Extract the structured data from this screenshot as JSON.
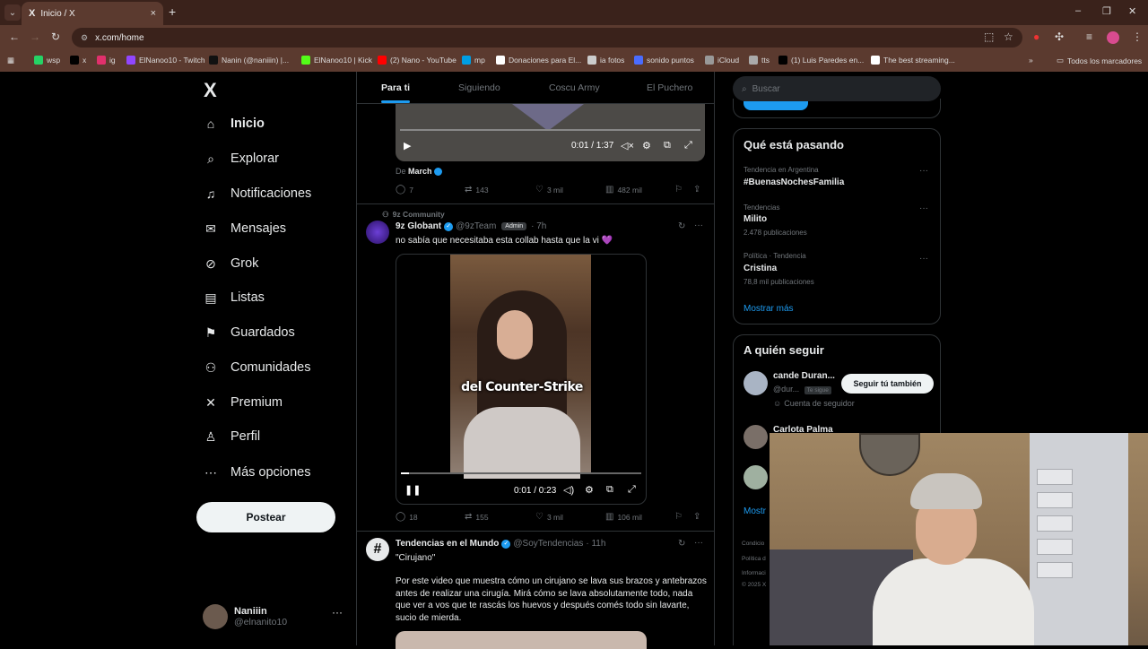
{
  "browser": {
    "tab_title": "Inicio / X",
    "tab_close": "×",
    "new_tab": "+",
    "url": "x.com/home",
    "win_min": "–",
    "win_max": "❐",
    "win_close": "✕",
    "bookmarks": [
      {
        "label": "wsp",
        "color": "#25d366"
      },
      {
        "label": "x",
        "color": "#000000"
      },
      {
        "label": "ig",
        "color": "#e1306c"
      },
      {
        "label": "ElNanoo10 - Twitch",
        "color": "#9146ff"
      },
      {
        "label": "Nanin (@naniiin) |...",
        "color": "#111111"
      },
      {
        "label": "ElNanoo10 | Kick",
        "color": "#53fc18"
      },
      {
        "label": "(2) Nano - YouTube",
        "color": "#ff0000"
      },
      {
        "label": "mp",
        "color": "#009ee3"
      },
      {
        "label": "Donaciones para El...",
        "color": "#ffffff"
      },
      {
        "label": "ia fotos",
        "color": "#cccccc"
      },
      {
        "label": "sonido puntos",
        "color": "#4a6cff"
      },
      {
        "label": "iCloud",
        "color": "#999999"
      },
      {
        "label": "tts",
        "color": "#aaaaaa"
      },
      {
        "label": "(1) Luis Paredes en...",
        "color": "#000000"
      },
      {
        "label": "The best streaming...",
        "color": "#ffffff"
      }
    ],
    "bookmarks_more": "»",
    "all_bookmarks": "Todos los marcadores"
  },
  "nav": {
    "logo": "X",
    "items": [
      {
        "label": "Inicio",
        "icon": "home-icon",
        "glyph": "⌂"
      },
      {
        "label": "Explorar",
        "icon": "search-icon",
        "glyph": "⌕"
      },
      {
        "label": "Notificaciones",
        "icon": "bell-icon",
        "glyph": "♫"
      },
      {
        "label": "Mensajes",
        "icon": "mail-icon",
        "glyph": "✉"
      },
      {
        "label": "Grok",
        "icon": "grok-icon",
        "glyph": "⊘"
      },
      {
        "label": "Listas",
        "icon": "list-icon",
        "glyph": "▤"
      },
      {
        "label": "Guardados",
        "icon": "bookmark-icon",
        "glyph": "⚑"
      },
      {
        "label": "Comunidades",
        "icon": "communities-icon",
        "glyph": "⚇"
      },
      {
        "label": "Premium",
        "icon": "x-premium-icon",
        "glyph": "✕"
      },
      {
        "label": "Perfil",
        "icon": "profile-icon",
        "glyph": "♙"
      },
      {
        "label": "Más opciones",
        "icon": "more-icon",
        "glyph": "⋯"
      }
    ],
    "post_button": "Postear",
    "account": {
      "name": "Naniiin",
      "handle": "@elnanito10",
      "more": "···"
    }
  },
  "feed": {
    "tabs": [
      "Para ti",
      "Siguiendo",
      "Coscu Army",
      "El Puchero"
    ],
    "post1": {
      "video_time": "0:01 / 1:37",
      "from_prefix": "De",
      "from_name": "March",
      "replies": "7",
      "reposts": "143",
      "likes": "3 mil",
      "views": "482 mil"
    },
    "post2": {
      "context": "9z Community",
      "name": "9z Globant",
      "handle": "@9zTeam",
      "badge": "Admin",
      "time": "· 7h",
      "text": "no sabía que necesitaba esta collab hasta que la vi 💜",
      "video_caption": "del Counter-Strike",
      "video_time": "0:01 / 0:23",
      "replies": "18",
      "reposts": "155",
      "likes": "3 mil",
      "views": "106 mil"
    },
    "post3": {
      "name": "Tendencias en el Mundo",
      "handle": "@SoyTendencias",
      "time": "· 11h",
      "quote": "\"Cirujano\"",
      "text": "Por este video que muestra cómo un cirujano se lava sus brazos y antebrazos antes de realizar una cirugía. Mirá cómo se lava absolutamente todo, nada que ver a vos que te rascás los huevos y después comés todo sin lavarte, sucio de mierda."
    }
  },
  "right": {
    "search_placeholder": "Buscar",
    "trends_title": "Qué está pasando",
    "trends": [
      {
        "sub": "Tendencia en Argentina",
        "title": "#BuenasNochesFamilia",
        "count": ""
      },
      {
        "sub": "Tendencias",
        "title": "Milito",
        "count": "2.478 publicaciones"
      },
      {
        "sub": "Política · Tendencia",
        "title": "Cristina",
        "count": "78,8 mil publicaciones"
      }
    ],
    "show_more": "Mostrar más",
    "follow_title": "A quién seguir",
    "follow": [
      {
        "name": "cande Duran...",
        "handle": "@dur...",
        "tag": "Te sigue",
        "note": "Cuenta de seguidor",
        "button": "Seguir tú también"
      },
      {
        "name": "Carlota Palma"
      }
    ],
    "follow_more": "Mostr",
    "legal": [
      "Condicio",
      "Política d",
      "Informaci",
      "© 2025 X"
    ]
  },
  "colors": {
    "accent": "#1d9bf0",
    "bg": "#000000",
    "border": "#2f3336",
    "muted": "#71767b"
  }
}
